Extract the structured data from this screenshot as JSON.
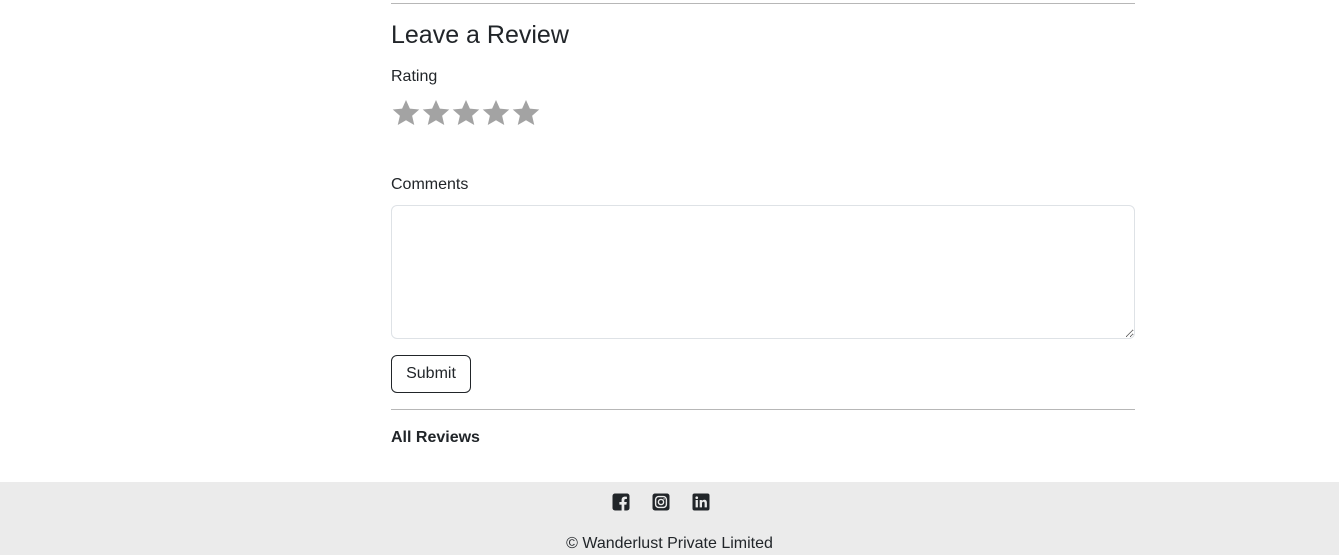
{
  "review_form": {
    "heading": "Leave a Review",
    "rating_label": "Rating",
    "rating": {
      "max": 5,
      "selected": 0,
      "star_color": "#a3a3a3"
    },
    "comments_label": "Comments",
    "comments_value": "",
    "submit_label": "Submit"
  },
  "reviews": {
    "heading": "All Reviews"
  },
  "footer": {
    "social_icons": [
      "facebook-icon",
      "instagram-icon",
      "linkedin-icon"
    ],
    "copyright": "© Wanderlust Private Limited",
    "background": "#ebebeb"
  }
}
